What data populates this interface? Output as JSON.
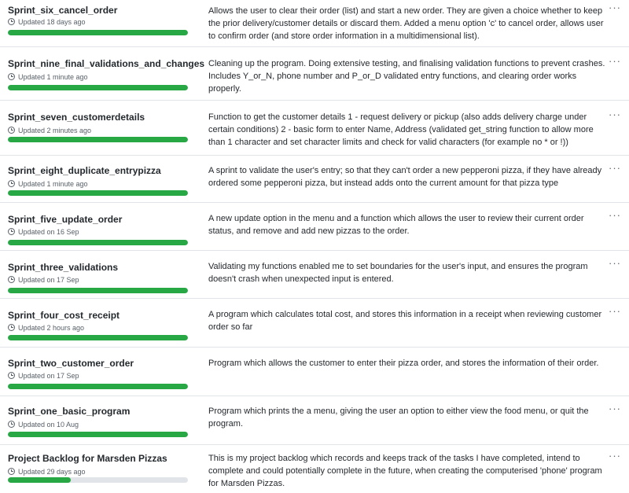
{
  "projects": [
    {
      "name": "Sprint_six_cancel_order",
      "updated": "Updated 18 days ago",
      "progress": 1.0,
      "description": "Allows the user to clear their order (list) and start a new order. They are given a choice whether to keep the prior delivery/customer details or discard them. Added a menu option 'c' to cancel order, allows user to confirm order (and store order information in a multidimensional list).",
      "menu_icon": "kebab-horizontal-icon"
    },
    {
      "name": "Sprint_nine_final_validations_and_changes",
      "updated": "Updated 1 minute ago",
      "progress": 1.0,
      "description": "Cleaning up the program. Doing extensive testing, and finalising validation functions to prevent crashes. Includes Y_or_N, phone number and P_or_D validated entry functions, and clearing order works properly.",
      "menu_icon": "kebab-horizontal-icon"
    },
    {
      "name": "Sprint_seven_customerdetails",
      "updated": "Updated 2 minutes ago",
      "progress": 1.0,
      "description": "Function to get the customer details 1 - request delivery or pickup (also adds delivery charge under certain conditions) 2 - basic form to enter Name, Address (validated get_string function to allow more than 1 character and set character limits and check for valid characters (for example no * or !))",
      "menu_icon": "kebab-horizontal-icon"
    },
    {
      "name": "Sprint_eight_duplicate_entrypizza",
      "updated": "Updated 1 minute ago",
      "progress": 1.0,
      "description": "A sprint to validate the user's entry; so that they can't order a new pepperoni pizza, if they have already ordered some pepperoni pizza, but instead adds onto the current amount for that pizza type",
      "menu_icon": "kebab-horizontal-icon"
    },
    {
      "name": "Sprint_five_update_order",
      "updated": "Updated on 16 Sep",
      "progress": 1.0,
      "description": "A new update option in the menu and a function which allows the user to review their current order status, and remove and add new pizzas to the order.",
      "menu_icon": "kebab-horizontal-icon"
    },
    {
      "name": "Sprint_three_validations",
      "updated": "Updated on 17 Sep",
      "progress": 1.0,
      "description": "Validating my functions enabled me to set boundaries for the user's input, and ensures the program doesn't crash when unexpected input is entered.",
      "menu_icon": "kebab-horizontal-icon"
    },
    {
      "name": "Sprint_four_cost_receipt",
      "updated": "Updated 2 hours ago",
      "progress": 1.0,
      "description": "A program which calculates total cost, and stores this information in a receipt when reviewing customer order so far",
      "menu_icon": "kebab-horizontal-icon"
    },
    {
      "name": "Sprint_two_customer_order",
      "updated": "Updated on 17 Sep",
      "progress": 1.0,
      "description": "Program which allows the customer to enter their pizza order, and stores the information of their order.",
      "menu_icon": "kebab-horizontal-icon"
    },
    {
      "name": "Sprint_one_basic_program",
      "updated": "Updated on 10 Aug",
      "progress": 1.0,
      "description": "Program which prints the a menu, giving the user an option to either view the food menu, or quit the program.",
      "menu_icon": "kebab-horizontal-icon"
    },
    {
      "name": "Project Backlog for Marsden Pizzas",
      "updated": "Updated 29 days ago",
      "progress": 0.35,
      "description": "This is my project backlog which records and keeps track of the tasks I have completed, intend to complete and could potentially complete in the future, when creating the computerised 'phone' program for Marsden Pizzas.",
      "menu_icon": "kebab-horizontal-icon"
    }
  ],
  "colors": {
    "progress_fill": "#28a745",
    "progress_track": "#e1e4e8",
    "text": "#24292e",
    "muted": "#586069"
  }
}
